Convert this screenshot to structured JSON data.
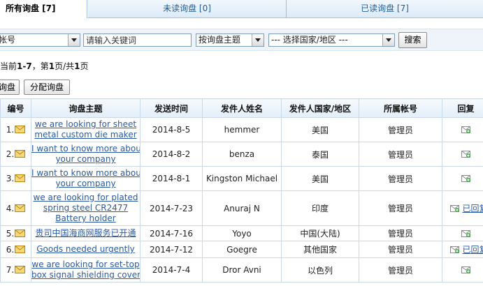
{
  "tabs": {
    "all": "所有询盘 [7]",
    "unread": "未读询盘 [0]",
    "read": "已读询盘 [7]"
  },
  "filters": {
    "account_select": "帐号",
    "keyword_placeholder": "请输入关键词",
    "subject_select": "按询盘主题",
    "country_select": "--- 选择国家/地区 ---",
    "search_button": "搜索"
  },
  "pageinfo": {
    "prefix": "当前",
    "range": "1-7",
    "mid1": "，第",
    "page": "1",
    "mid2": "页/共",
    "total": "1",
    "suffix": "页"
  },
  "actions": {
    "partial_button": "询盘",
    "assign_button": "分配询盘"
  },
  "table": {
    "headers": [
      "编号",
      "询盘主题",
      "发送时间",
      "发件人姓名",
      "发件人国家/地区",
      "所属帐号",
      "回复"
    ],
    "rows": [
      {
        "no": "1.",
        "subject": [
          "we are looking for sheet",
          "metal custom die maker"
        ],
        "time": "2014-8-5",
        "name": "hemmer",
        "country": "美国",
        "account": "管理员",
        "reply": ""
      },
      {
        "no": "2.",
        "subject": [
          "I want to know more about",
          "your company"
        ],
        "time": "2014-8-2",
        "name": "benza",
        "country": "泰国",
        "account": "管理员",
        "reply": ""
      },
      {
        "no": "3.",
        "subject": [
          "I want to know more about",
          "your company"
        ],
        "time": "2014-8-1",
        "name": "Kingston Michael",
        "country": "美国",
        "account": "管理员",
        "reply": ""
      },
      {
        "no": "4.",
        "subject": [
          "we are looking for plated",
          "spring steel CR2477",
          "Battery holder"
        ],
        "time": "2014-7-23",
        "name": "Anuraj N",
        "country": "印度",
        "account": "管理员",
        "reply": "已回复"
      },
      {
        "no": "5.",
        "subject": [
          "贵司中国海商网服务已开通"
        ],
        "time": "2014-7-16",
        "name": "Yoyo",
        "country": "中国(大陆)",
        "account": "管理员",
        "reply": ""
      },
      {
        "no": "6.",
        "subject": [
          "Goods needed urgently"
        ],
        "time": "2014-7-12",
        "name": "Goegre",
        "country": "其他国家",
        "account": "管理员",
        "reply": "已回复"
      },
      {
        "no": "7.",
        "subject": [
          "we are looking for set-top",
          "box signal shielding cover"
        ],
        "time": "2014-7-4",
        "name": "Dror Avni",
        "country": "以色列",
        "account": "管理员",
        "reply": ""
      }
    ]
  }
}
